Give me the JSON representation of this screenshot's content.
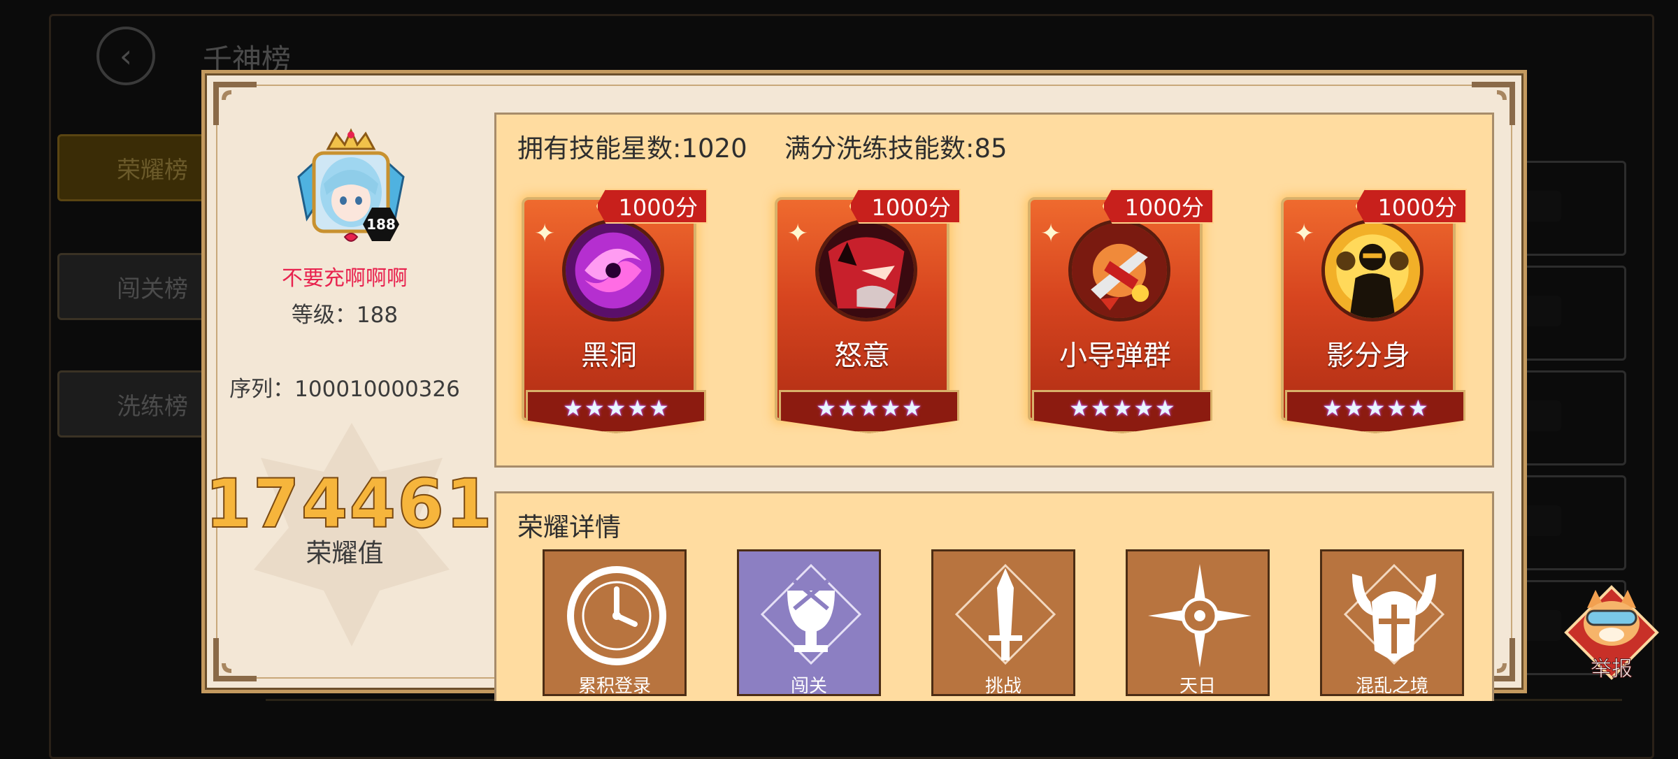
{
  "background": {
    "title": "千神榜",
    "tabs": [
      "荣耀榜",
      "闯关榜",
      "洗练榜"
    ]
  },
  "profile": {
    "name": "不要充啊啊啊",
    "level_badge": "188",
    "level_text": "等级：188",
    "serial_text": "序列：100010000326",
    "honor_value": "174461",
    "honor_label": "荣耀值"
  },
  "skills_panel": {
    "stars_total": "拥有技能星数:1020",
    "maxed_count": "满分洗练技能数:85",
    "cards": [
      {
        "name": "黑洞",
        "score": "1000分",
        "stars": 5,
        "icon": "black-hole-icon"
      },
      {
        "name": "怒意",
        "score": "1000分",
        "stars": 5,
        "icon": "rage-demon-icon"
      },
      {
        "name": "小导弹群",
        "score": "1000分",
        "stars": 5,
        "icon": "missile-swarm-icon"
      },
      {
        "name": "影分身",
        "score": "1000分",
        "stars": 5,
        "icon": "shadow-clone-icon"
      }
    ]
  },
  "honor_panel": {
    "title": "荣耀详情",
    "items": [
      {
        "label": "累积登录",
        "icon": "clock-icon",
        "color": "#b8743f"
      },
      {
        "label": "闯关",
        "icon": "trophy-icon",
        "color": "#8c7fc2"
      },
      {
        "label": "挑战",
        "icon": "sword-icon",
        "color": "#b8743f"
      },
      {
        "label": "天日",
        "icon": "compass-star-icon",
        "color": "#b8743f"
      },
      {
        "label": "混乱之境",
        "icon": "horned-helmet-icon",
        "color": "#b8743f"
      }
    ]
  },
  "report_button": {
    "label": "举报"
  },
  "colors": {
    "dialog_bg": "#f3e7d6",
    "panel_bg": "#ffdca0",
    "name_pink": "#e8224e",
    "honor_gold": "#f6b53c",
    "card_red": "#d7451f"
  }
}
